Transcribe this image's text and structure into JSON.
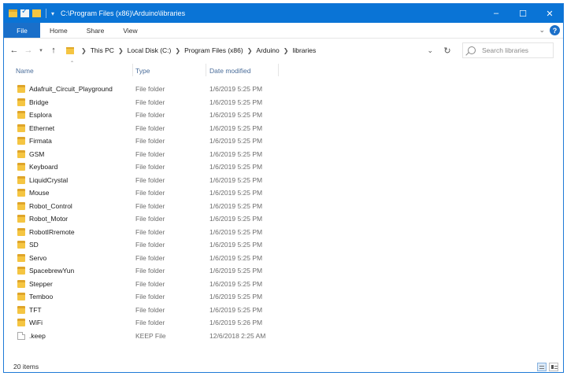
{
  "window": {
    "title": "C:\\Program Files (x86)\\Arduino\\libraries",
    "controls": {
      "minimize": "–",
      "maximize": "☐",
      "close": "✕"
    }
  },
  "ribbon": {
    "tabs": [
      "File",
      "Home",
      "Share",
      "View"
    ],
    "help": "?"
  },
  "address": {
    "crumbs": [
      "This PC",
      "Local Disk (C:)",
      "Program Files (x86)",
      "Arduino",
      "libraries"
    ]
  },
  "search": {
    "placeholder": "Search libraries"
  },
  "columns": {
    "name": "Name",
    "type": "Type",
    "date": "Date modified"
  },
  "items": [
    {
      "name": "Adafruit_Circuit_Playground",
      "type": "File folder",
      "date": "1/6/2019 5:25 PM",
      "icon": "folder-icon"
    },
    {
      "name": "Bridge",
      "type": "File folder",
      "date": "1/6/2019 5:25 PM",
      "icon": "folder-icon"
    },
    {
      "name": "Esplora",
      "type": "File folder",
      "date": "1/6/2019 5:25 PM",
      "icon": "folder-icon"
    },
    {
      "name": "Ethernet",
      "type": "File folder",
      "date": "1/6/2019 5:25 PM",
      "icon": "folder-icon"
    },
    {
      "name": "Firmata",
      "type": "File folder",
      "date": "1/6/2019 5:25 PM",
      "icon": "folder-icon"
    },
    {
      "name": "GSM",
      "type": "File folder",
      "date": "1/6/2019 5:25 PM",
      "icon": "folder-icon"
    },
    {
      "name": "Keyboard",
      "type": "File folder",
      "date": "1/6/2019 5:25 PM",
      "icon": "folder-icon"
    },
    {
      "name": "LiquidCrystal",
      "type": "File folder",
      "date": "1/6/2019 5:25 PM",
      "icon": "folder-icon"
    },
    {
      "name": "Mouse",
      "type": "File folder",
      "date": "1/6/2019 5:25 PM",
      "icon": "folder-icon"
    },
    {
      "name": "Robot_Control",
      "type": "File folder",
      "date": "1/6/2019 5:25 PM",
      "icon": "folder-icon"
    },
    {
      "name": "Robot_Motor",
      "type": "File folder",
      "date": "1/6/2019 5:25 PM",
      "icon": "folder-icon"
    },
    {
      "name": "RobotIRremote",
      "type": "File folder",
      "date": "1/6/2019 5:25 PM",
      "icon": "folder-icon"
    },
    {
      "name": "SD",
      "type": "File folder",
      "date": "1/6/2019 5:25 PM",
      "icon": "folder-icon"
    },
    {
      "name": "Servo",
      "type": "File folder",
      "date": "1/6/2019 5:25 PM",
      "icon": "folder-icon"
    },
    {
      "name": "SpacebrewYun",
      "type": "File folder",
      "date": "1/6/2019 5:25 PM",
      "icon": "folder-icon"
    },
    {
      "name": "Stepper",
      "type": "File folder",
      "date": "1/6/2019 5:25 PM",
      "icon": "folder-icon"
    },
    {
      "name": "Temboo",
      "type": "File folder",
      "date": "1/6/2019 5:25 PM",
      "icon": "folder-icon"
    },
    {
      "name": "TFT",
      "type": "File folder",
      "date": "1/6/2019 5:25 PM",
      "icon": "folder-icon"
    },
    {
      "name": "WiFi",
      "type": "File folder",
      "date": "1/6/2019 5:26 PM",
      "icon": "folder-icon"
    },
    {
      "name": ".keep",
      "type": "KEEP File",
      "date": "12/6/2018 2:25 AM",
      "icon": "file-icon"
    }
  ],
  "status": {
    "count": "20 items"
  },
  "colors": {
    "accent": "#0a74d6",
    "folder": "#f5c542",
    "header_text": "#4a6d9a"
  }
}
